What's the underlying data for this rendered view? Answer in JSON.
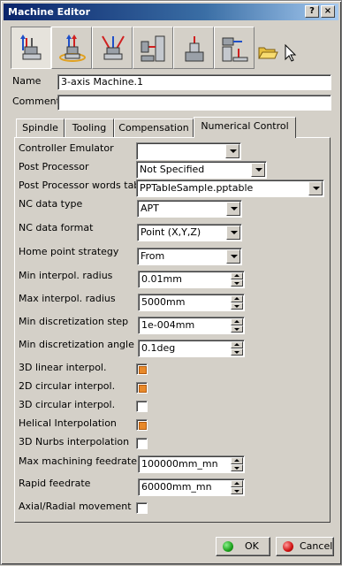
{
  "window": {
    "title": "Machine Editor",
    "help_label": "?",
    "close_label": "×"
  },
  "toolbar": {
    "icons": [
      "machine-3axis-icon",
      "machine-rotary-table-icon",
      "machine-5axis-icon",
      "horizontal-machine-icon",
      "vertical-machine-icon",
      "lathe-machine-icon",
      "open-folder-icon",
      "select-arrow-icon"
    ]
  },
  "name": {
    "label": "Name",
    "value": "3-axis Machine.1"
  },
  "comment": {
    "label": "Comment",
    "value": ""
  },
  "tabs": [
    "Spindle",
    "Tooling",
    "Compensation",
    "Numerical Control"
  ],
  "active_tab": "Numerical Control",
  "fields": {
    "controller_emulator": {
      "label": "Controller Emulator",
      "value": ""
    },
    "post_processor": {
      "label": "Post Processor",
      "value": "Not Specified"
    },
    "pp_words_table": {
      "label": "Post Processor words table",
      "value": "PPTableSample.pptable"
    },
    "nc_data_type": {
      "label": "NC data type",
      "value": "APT"
    },
    "nc_data_format": {
      "label": "NC data format",
      "value": "Point (X,Y,Z)"
    },
    "home_point_strategy": {
      "label": "Home point strategy",
      "value": "From"
    },
    "min_interpol_radius": {
      "label": "Min interpol. radius",
      "value": "0.01mm"
    },
    "max_interpol_radius": {
      "label": "Max interpol. radius",
      "value": "5000mm"
    },
    "min_discretization_step": {
      "label": "Min discretization step",
      "value": "1e-004mm"
    },
    "min_discretization_angle": {
      "label": "Min discretization angle",
      "value": "0.1deg"
    },
    "linear_3d": {
      "label": "3D linear interpol.",
      "checked": true
    },
    "circular_2d": {
      "label": "2D circular interpol.",
      "checked": true
    },
    "circular_3d": {
      "label": "3D circular interpol.",
      "checked": false
    },
    "helical": {
      "label": "Helical Interpolation",
      "checked": true
    },
    "nurbs_3d": {
      "label": "3D Nurbs interpolation",
      "checked": false
    },
    "max_machining_feedrate": {
      "label": "Max machining feedrate",
      "value": "100000mm_mn"
    },
    "rapid_feedrate": {
      "label": "Rapid feedrate",
      "value": "60000mm_mn"
    },
    "axial_radial": {
      "label": "Axial/Radial movement",
      "checked": false
    }
  },
  "buttons": {
    "ok": "OK",
    "cancel": "Cancel"
  },
  "colors": {
    "title_start": "#0a246a",
    "check_mark": "#e8892a",
    "ok_icon": "#1aa01a",
    "cancel_icon": "#d01010"
  }
}
